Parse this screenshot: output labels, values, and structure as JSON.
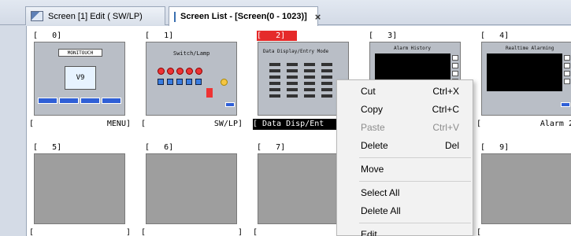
{
  "tabs": [
    {
      "label": "Screen [1] Edit (        SW/LP)",
      "icon": "screen-edit-icon",
      "active": false
    },
    {
      "label": "Screen List - [Screen(0 - 1023)]",
      "icon": "screen-list-icon",
      "active": true,
      "close": "×"
    }
  ],
  "screens": [
    {
      "number": "[   0]",
      "name": "MENU]",
      "open_bracket": "[",
      "selected": false,
      "thumb": "menu"
    },
    {
      "number": "[   1]",
      "name": "SW/LP]",
      "open_bracket": "[",
      "selected": false,
      "thumb": "switch"
    },
    {
      "number": "[   2]",
      "name": "Data Disp/Ent",
      "open_bracket": "[",
      "selected": true,
      "thumb": "data"
    },
    {
      "number": "[   3]",
      "name": "",
      "open_bracket": "",
      "selected": false,
      "thumb": "alarm-history"
    },
    {
      "number": "[   4]",
      "name": "Alarm 2]",
      "open_bracket": "[",
      "selected": false,
      "thumb": "realtime"
    },
    {
      "number": "[   5]",
      "name": "]",
      "open_bracket": "[",
      "selected": false,
      "thumb": "empty"
    },
    {
      "number": "[   6]",
      "name": "]",
      "open_bracket": "[",
      "selected": false,
      "thumb": "empty"
    },
    {
      "number": "[   7]",
      "name": "",
      "open_bracket": "[",
      "selected": false,
      "thumb": "empty"
    },
    {
      "number": "",
      "name": "",
      "open_bracket": "",
      "selected": false,
      "thumb": "empty"
    },
    {
      "number": "[   9]",
      "name": "]",
      "open_bracket": "[",
      "selected": false,
      "thumb": "empty"
    }
  ],
  "thumb_text": {
    "menu_title": "MONITOUCH",
    "menu_logo": "V9",
    "switch_title": "Switch/Lamp",
    "data_title": "Data Display/Entry Mode",
    "alarm_history_title": "Alarm History",
    "realtime_title": "Realtime Alarming"
  },
  "context_menu": [
    {
      "label": "Cut",
      "shortcut": "Ctrl+X",
      "enabled": true
    },
    {
      "label": "Copy",
      "shortcut": "Ctrl+C",
      "enabled": true
    },
    {
      "label": "Paste",
      "shortcut": "Ctrl+V",
      "enabled": false
    },
    {
      "label": "Delete",
      "shortcut": "Del",
      "enabled": true
    },
    {
      "separator": true
    },
    {
      "label": "Move",
      "shortcut": "",
      "enabled": true
    },
    {
      "separator": true
    },
    {
      "label": "Select All",
      "shortcut": "",
      "enabled": true
    },
    {
      "label": "Delete All",
      "shortcut": "",
      "enabled": true
    },
    {
      "separator": true
    },
    {
      "label": "Edit",
      "shortcut": "",
      "enabled": true
    }
  ],
  "colors": {
    "selected_number_bg": "#e52a2a",
    "selected_name_bg": "#000000",
    "empty_thumb": "#9e9e9e"
  }
}
